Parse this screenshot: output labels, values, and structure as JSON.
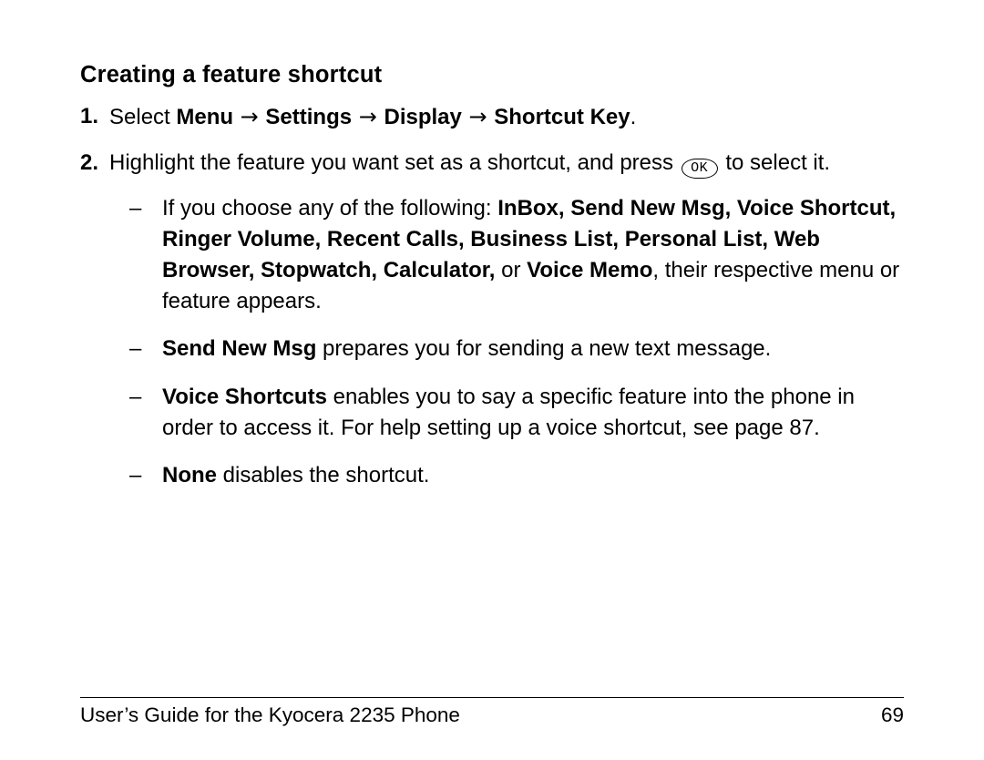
{
  "heading": "Creating a feature shortcut",
  "step1": {
    "num": "1.",
    "lead": "Select ",
    "menu": "Menu",
    "settings": "Settings",
    "display": "Display",
    "shortcut": "Shortcut Key",
    "arrow": " → ",
    "period": "."
  },
  "step2": {
    "num": "2.",
    "part_a": "Highlight the feature you want set as a shortcut, and press ",
    "ok_label": "OK",
    "part_b": "  to select it.",
    "bullets": {
      "b1": {
        "dash": "–",
        "lead": "If you choose any of the following: ",
        "bold_list": "InBox, Send New Msg, Voice Shortcut, Ringer Volume, Recent Calls, Business List, Personal List, Web Browser, Stopwatch, Calculator,",
        "or": " or ",
        "voice_memo": "Voice Memo",
        "tail": ", their respective menu or feature appears."
      },
      "b2": {
        "dash": "–",
        "bold": "Send New Msg",
        "tail": " prepares you for sending a new text message."
      },
      "b3": {
        "dash": "–",
        "bold": "Voice Shortcuts",
        "tail": " enables you to say a specific feature into the phone in order to access it. For help setting up a voice shortcut, see page 87."
      },
      "b4": {
        "dash": "–",
        "bold": "None",
        "tail": " disables the shortcut."
      }
    }
  },
  "footer": {
    "title": "User’s Guide for the Kyocera 2235 Phone",
    "page": "69"
  }
}
